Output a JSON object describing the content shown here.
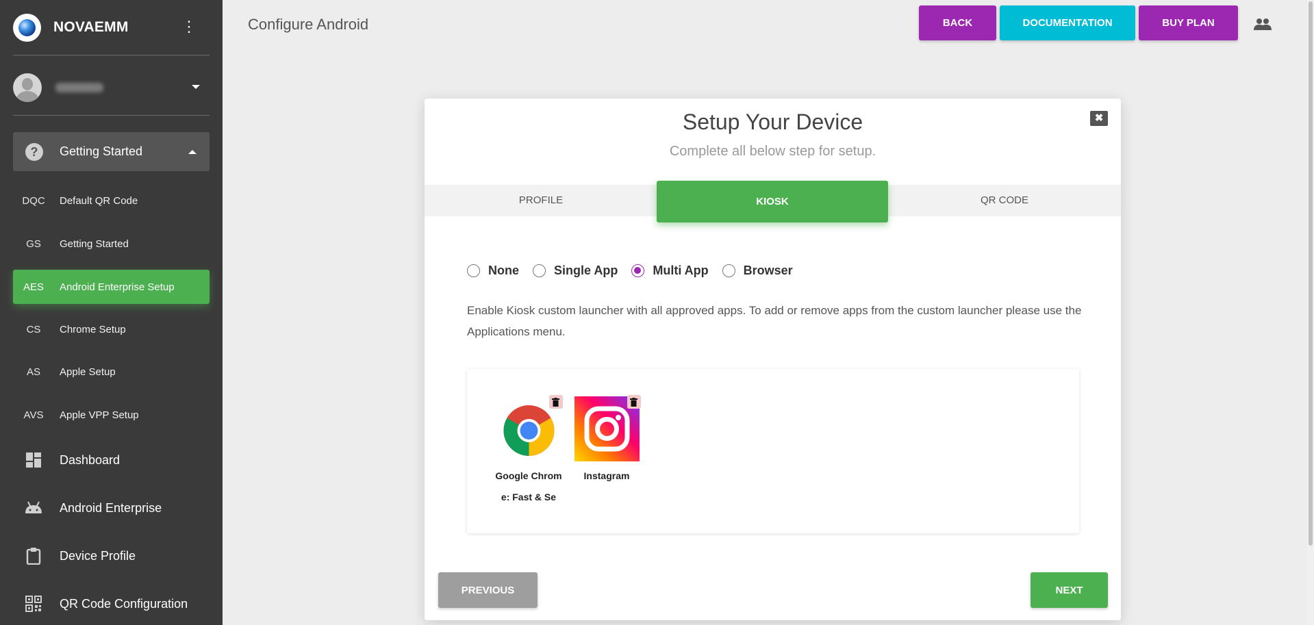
{
  "sidebar": {
    "brand": "NOVAEMM",
    "section": "Getting Started",
    "sub_items": [
      {
        "abbr": "DQC",
        "label": "Default QR Code"
      },
      {
        "abbr": "GS",
        "label": "Getting Started"
      },
      {
        "abbr": "AES",
        "label": "Android Enterprise Setup"
      },
      {
        "abbr": "CS",
        "label": "Chrome Setup"
      },
      {
        "abbr": "AS",
        "label": "Apple Setup"
      },
      {
        "abbr": "AVS",
        "label": "Apple VPP Setup"
      }
    ],
    "main_items": [
      {
        "label": "Dashboard",
        "icon": "dashboard-icon"
      },
      {
        "label": "Android Enterprise",
        "icon": "android-icon"
      },
      {
        "label": "Device Profile",
        "icon": "clipboard-icon"
      },
      {
        "label": "QR Code Configuration",
        "icon": "qr-code-icon"
      }
    ]
  },
  "header": {
    "title": "Configure Android",
    "back": "BACK",
    "documentation": "DOCUMENTATION",
    "buy_plan": "BUY PLAN"
  },
  "modal": {
    "title": "Setup Your Device",
    "subtitle": "Complete all below step for setup.",
    "tabs": [
      "PROFILE",
      "KIOSK",
      "QR CODE"
    ],
    "active_tab": "KIOSK",
    "kiosk_options": [
      "None",
      "Single App",
      "Multi App",
      "Browser"
    ],
    "selected_option": "Multi App",
    "description": "Enable Kiosk custom launcher with all approved apps. To add or remove apps from the custom launcher please use the Applications menu.",
    "apps": [
      {
        "name": "Google Chrome: Fast & Se",
        "icon": "chrome-icon"
      },
      {
        "name": "Instagram",
        "icon": "instagram-icon"
      }
    ],
    "previous": "PREVIOUS",
    "next": "NEXT"
  },
  "colors": {
    "sidebar_bg": "#3a3a3a",
    "green": "#4caf50",
    "purple": "#9c27b0",
    "cyan": "#00bcd4",
    "gray_button": "#9e9e9e"
  }
}
